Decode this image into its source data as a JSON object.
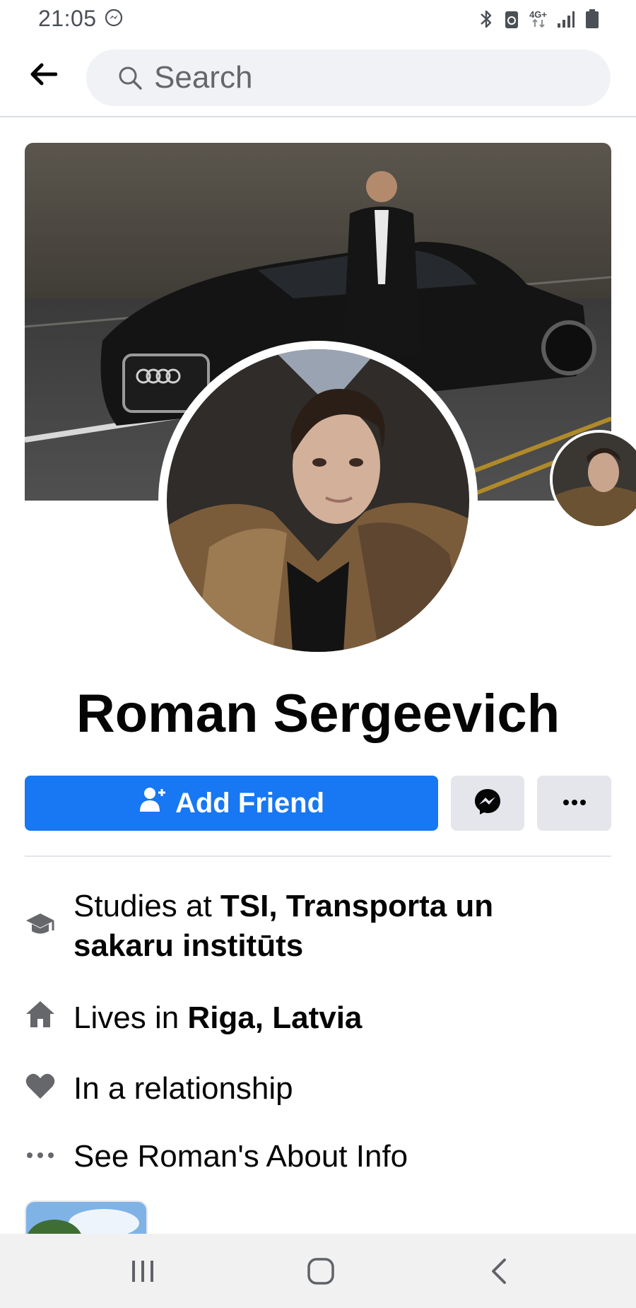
{
  "status_bar": {
    "time": "21:05",
    "left_icon": "messenger-notification-icon",
    "right_icons": [
      "bluetooth-icon",
      "battery-saver-icon",
      "4g-icon",
      "signal-icon",
      "battery-icon"
    ],
    "network_label": "4G+"
  },
  "header": {
    "back_icon": "arrow-left-icon",
    "search_placeholder": "Search"
  },
  "profile": {
    "name": "Roman Sergeevich"
  },
  "actions": {
    "add_friend_label": "Add Friend",
    "messenger_icon": "messenger-icon",
    "more_icon": "ellipsis-icon"
  },
  "intro": {
    "studies_prefix": "Studies at ",
    "studies_place": "TSI, Transporta un",
    "studies_place_line2": "sakaru institūts",
    "lives_prefix": "Lives in ",
    "lives_place": "Riga, Latvia",
    "relationship": "In a relationship",
    "about_link": "See Roman's About Info"
  },
  "colors": {
    "primary": "#1877f2",
    "secondary_button": "#e4e6eb",
    "icon_gray": "#65676b"
  },
  "nav": {
    "recent_icon": "recent-apps-icon",
    "home_icon": "home-circle-icon",
    "back_icon": "back-chevron-icon"
  }
}
